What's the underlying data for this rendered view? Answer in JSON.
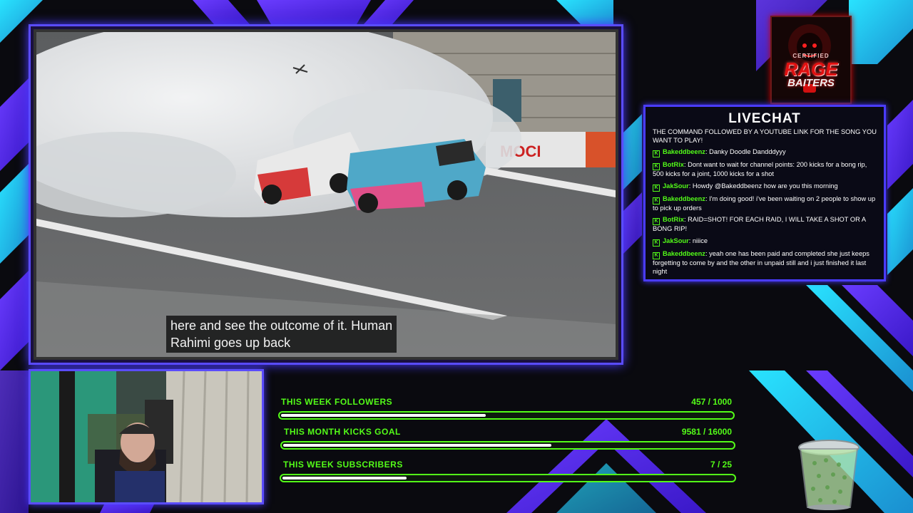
{
  "video": {
    "caption_line1": "here and see the outcome of it. Human",
    "caption_line2": "Rahimi goes up back",
    "banner_text": "MOCI"
  },
  "logo": {
    "line1": "CERTIFIED",
    "line2": "RAGE",
    "line3": "BAITERS"
  },
  "chat": {
    "title": "LIVECHAT",
    "command_text": "THE COMMAND FOLLOWED BY A YOUTUBE LINK FOR THE SONG YOU WANT TO PLAY!",
    "messages": [
      {
        "user": "Bakeddbeenz",
        "text": "Danky Doodle Dandddyyy"
      },
      {
        "user": "BotRix",
        "text": "Dont want to wait for channel points: 200 kicks for a bong rip, 500 kicks for a joint, 1000 kicks for a shot"
      },
      {
        "user": "JakSour",
        "text": "Howdy @Bakeddbeenz how are you this morning"
      },
      {
        "user": "Bakeddbeenz",
        "text": "I'm doing good! i've been waiting on 2 people to show up to pick up orders"
      },
      {
        "user": "BotRix",
        "text": "RAID=SHOT! FOR EACH RAID, I WILL TAKE A SHOT OR A BONG RIP!"
      },
      {
        "user": "JakSour",
        "text": "niiice"
      },
      {
        "user": "Bakeddbeenz",
        "text": "yeah one has been paid and completed she just keeps forgetting to come by and the other in unpaid still and i just finished it last night"
      }
    ]
  },
  "goals": [
    {
      "label": "THIS WEEK FOLLOWERS",
      "count": "457 / 1000",
      "progress": 0.457
    },
    {
      "label": "THIS MONTH KICKS GOAL",
      "count": "9581 / 16000",
      "progress": 0.599
    },
    {
      "label": "THIS WEEK SUBSCRIBERS",
      "count": "7 / 25",
      "progress": 0.28
    }
  ],
  "colors": {
    "accent_purple": "#5a4cff",
    "accent_cyan": "#1ee8ff",
    "kick_green": "#53fc18"
  },
  "icons": {
    "chat_badge": "kick-badge-icon",
    "cup": "tip-jar-cup-icon"
  }
}
